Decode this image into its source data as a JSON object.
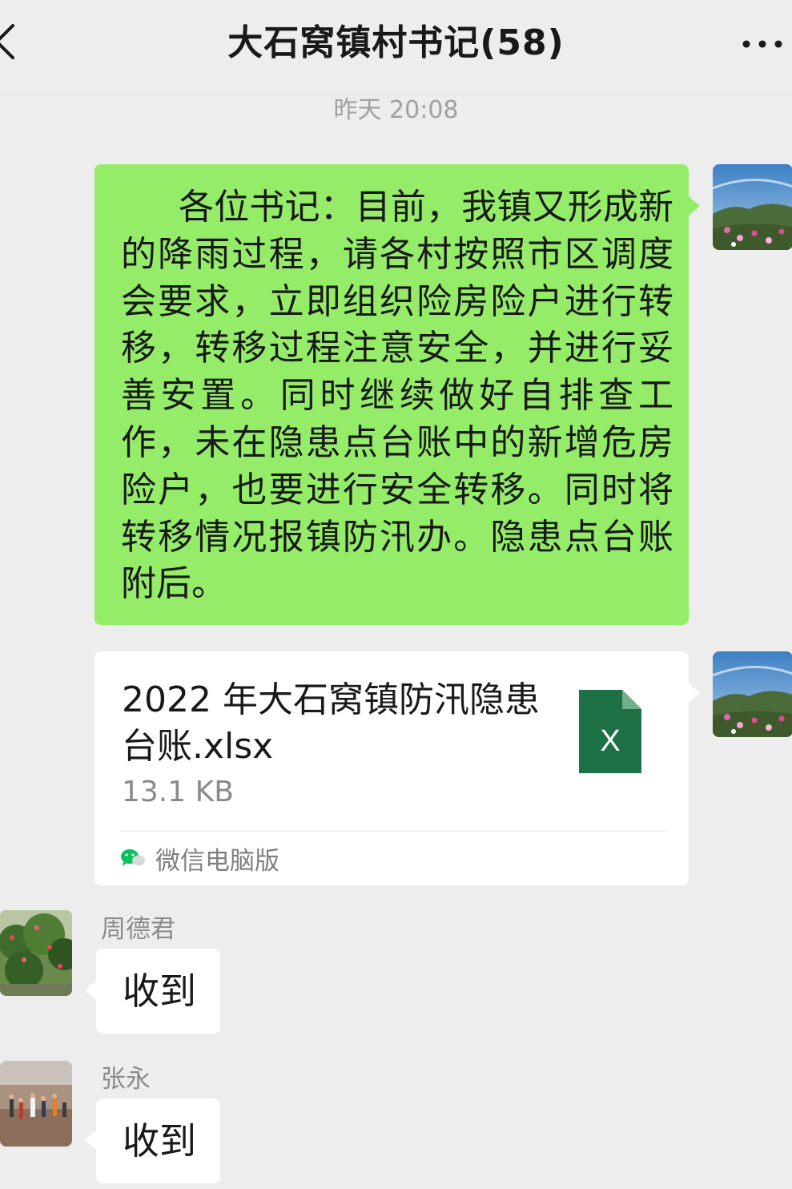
{
  "header": {
    "title": "大石窝镇村书记(58)",
    "back_icon": "chevron-left-icon",
    "more_icon": "ellipsis-icon"
  },
  "timestamp": "昨天 20:08",
  "outgoing_message": {
    "text": "各位书记：目前，我镇又形成新的降雨过程，请各村按照市区调度会要求，立即组织险房险户进行转移，转移过程注意安全，并进行妥善安置。同时继续做好自排查工作，未在隐患点台账中的新增危房险户，也要进行安全转移。同时将转移情况报镇防汛办。隐患点台账附后。"
  },
  "file_message": {
    "file_name": "2022 年大石窝镇防汛隐患台账.xlsx",
    "file_size": "13.1 KB",
    "icon_letter": "X",
    "source_label": "微信电脑版"
  },
  "replies": [
    {
      "sender": "周德君",
      "text": "收到"
    },
    {
      "sender": "张永",
      "text": "收到"
    }
  ],
  "colors": {
    "background": "#ededed",
    "outgoing_bubble": "#95ec69",
    "incoming_bubble": "#ffffff",
    "excel_green": "#1e7145",
    "wechat_green": "#07c160"
  }
}
